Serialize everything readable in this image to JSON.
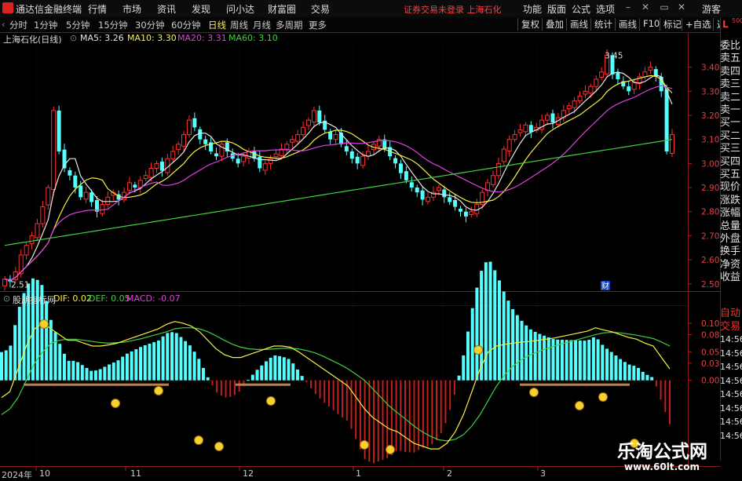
{
  "app": {
    "title": "通达信金融终端",
    "menu": [
      "行情",
      "市场",
      "资讯",
      "发现",
      "问小达",
      "财富圈",
      "交易"
    ],
    "notice": "证券交易未登录 上海石化",
    "right_menu": [
      "功能",
      "版面",
      "公式",
      "选项"
    ],
    "guest": "游客"
  },
  "toolbar": {
    "periods": [
      "分时",
      "1分钟",
      "5分钟",
      "15分钟",
      "30分钟",
      "60分钟",
      "日线",
      "周线",
      "月线",
      "多周期",
      "更多"
    ],
    "active_period": "日线",
    "buttons": [
      "复权",
      "叠加",
      "画线",
      "统计",
      "画线",
      "F10",
      "标记",
      "+自选",
      "返回"
    ]
  },
  "main_legend": {
    "stock": "上海石化(日线)",
    "ma": [
      {
        "label": "MA5: 3.26",
        "color": "#e8e8e8"
      },
      {
        "label": "MA10: 3.30",
        "color": "#f8f040"
      },
      {
        "label": "MA20: 3.31",
        "color": "#e040e0"
      },
      {
        "label": "MA60: 3.10",
        "color": "#40d040"
      }
    ]
  },
  "macd_legend": {
    "name": "股朋指标网",
    "dif": "DIF: 0.02",
    "def": "DEF: 0.05",
    "macd": "MACD: -0.07",
    "colors": {
      "dif": "#f8f040",
      "def": "#40d040",
      "macd": "#e040e0"
    }
  },
  "price_axis": {
    "ticks": [
      "3.40",
      "3.30",
      "3.20",
      "3.10",
      "3.00",
      "2.90",
      "2.80",
      "2.70",
      "2.60",
      "2.50"
    ],
    "high_label": "3.45",
    "low_label": "2.51",
    "fin_marker": "财"
  },
  "macd_axis": {
    "ticks": [
      "0.10",
      "0.08",
      "0.05",
      "0.03",
      "0.00"
    ]
  },
  "sidebar": {
    "corner": "L",
    "corner_num": "500",
    "items": [
      "委比",
      "卖五",
      "卖四",
      "卖三",
      "卖二",
      "卖一",
      "买一",
      "买二",
      "买三",
      "买四",
      "买五",
      "现价",
      "涨跌",
      "涨幅",
      "总量",
      "外盘",
      "换手",
      "净资",
      "收益"
    ],
    "lower_items": [
      "自动",
      "交易"
    ],
    "times": [
      "14:56",
      "14:56",
      "14:56",
      "14:56",
      "14:56",
      "14:56",
      "14:56",
      "14:56"
    ]
  },
  "x_labels": [
    "2024年",
    "10",
    "11",
    "12",
    "1",
    "2",
    "3"
  ],
  "watermark": {
    "cn": "乐淘公式网",
    "url": "www.60lt.com"
  },
  "chart_data": {
    "type": "candlestick",
    "price_range": [
      2.47,
      3.49
    ],
    "candles_note": "approx daily OHLC, Sep 2024 - Mar 2025",
    "close": [
      2.52,
      2.51,
      2.55,
      2.62,
      2.66,
      2.7,
      2.75,
      2.82,
      2.9,
      3.22,
      3.05,
      2.98,
      2.95,
      2.9,
      2.86,
      2.88,
      2.84,
      2.8,
      2.83,
      2.86,
      2.88,
      2.85,
      2.88,
      2.92,
      2.9,
      2.93,
      2.95,
      2.98,
      3.0,
      2.97,
      3.02,
      3.05,
      3.08,
      3.12,
      3.18,
      3.15,
      3.1,
      3.08,
      3.05,
      3.03,
      3.08,
      3.05,
      3.02,
      3.0,
      3.03,
      3.05,
      3.02,
      2.98,
      3.0,
      3.02,
      3.04,
      3.06,
      3.08,
      3.1,
      3.12,
      3.15,
      3.18,
      3.22,
      3.17,
      3.14,
      3.1,
      3.12,
      3.08,
      3.05,
      3.02,
      3.0,
      3.03,
      3.05,
      3.08,
      3.1,
      3.06,
      3.03,
      3.0,
      2.96,
      2.93,
      2.9,
      2.88,
      2.85,
      2.86,
      2.88,
      2.9,
      2.86,
      2.84,
      2.82,
      2.8,
      2.78,
      2.8,
      2.83,
      2.88,
      2.92,
      2.95,
      3.0,
      3.06,
      3.1,
      3.12,
      3.14,
      3.16,
      3.13,
      3.15,
      3.18,
      3.2,
      3.17,
      3.19,
      3.22,
      3.24,
      3.26,
      3.28,
      3.3,
      3.32,
      3.35,
      3.38,
      3.45,
      3.37,
      3.35,
      3.32,
      3.3,
      3.34,
      3.36,
      3.38,
      3.4,
      3.36,
      3.3,
      3.05,
      3.12
    ],
    "macd_range": [
      -0.15,
      0.13
    ],
    "dif": [
      -0.03,
      -0.02,
      0.02,
      0.06,
      0.09,
      0.1,
      0.09,
      0.08,
      0.07,
      0.07,
      0.065,
      0.06,
      0.06,
      0.062,
      0.065,
      0.07,
      0.075,
      0.08,
      0.085,
      0.09,
      0.098,
      0.103,
      0.1,
      0.095,
      0.085,
      0.07,
      0.055,
      0.045,
      0.04,
      0.04,
      0.045,
      0.05,
      0.055,
      0.06,
      0.06,
      0.058,
      0.05,
      0.04,
      0.03,
      0.02,
      0.01,
      0.0,
      -0.01,
      -0.03,
      -0.05,
      -0.065,
      -0.075,
      -0.085,
      -0.09,
      -0.1,
      -0.11,
      -0.115,
      -0.12,
      -0.12,
      -0.11,
      -0.09,
      -0.06,
      -0.02,
      0.02,
      0.05,
      0.06,
      0.063,
      0.065,
      0.067,
      0.068,
      0.07,
      0.072,
      0.074,
      0.077,
      0.08,
      0.083,
      0.086,
      0.092,
      0.088,
      0.085,
      0.08,
      0.075,
      0.072,
      0.065,
      0.06,
      0.04,
      0.02
    ],
    "def": [
      -0.06,
      -0.05,
      -0.03,
      0.0,
      0.03,
      0.05,
      0.065,
      0.07,
      0.072,
      0.072,
      0.07,
      0.068,
      0.066,
      0.065,
      0.066,
      0.067,
      0.07,
      0.073,
      0.077,
      0.081,
      0.085,
      0.09,
      0.092,
      0.092,
      0.09,
      0.085,
      0.078,
      0.07,
      0.063,
      0.058,
      0.055,
      0.054,
      0.054,
      0.055,
      0.056,
      0.056,
      0.055,
      0.052,
      0.048,
      0.042,
      0.035,
      0.028,
      0.02,
      0.01,
      0.0,
      -0.015,
      -0.03,
      -0.045,
      -0.057,
      -0.068,
      -0.08,
      -0.09,
      -0.098,
      -0.104,
      -0.106,
      -0.103,
      -0.095,
      -0.08,
      -0.06,
      -0.035,
      -0.01,
      0.01,
      0.025,
      0.036,
      0.044,
      0.05,
      0.055,
      0.06,
      0.064,
      0.068,
      0.072,
      0.076,
      0.08,
      0.083,
      0.084,
      0.083,
      0.081,
      0.079,
      0.076,
      0.073,
      0.067,
      0.06
    ]
  }
}
